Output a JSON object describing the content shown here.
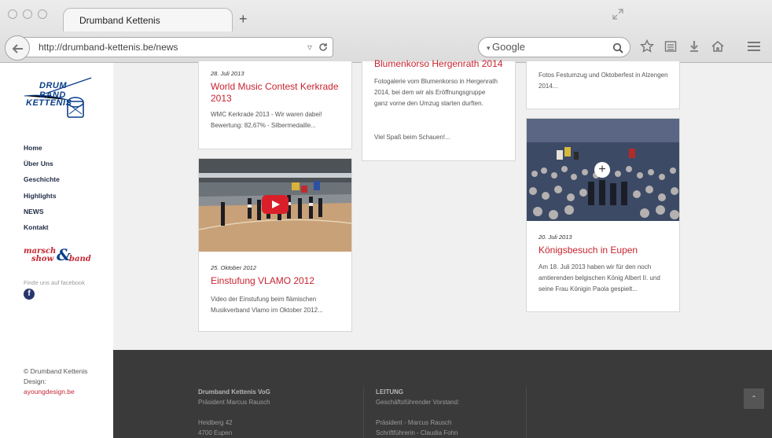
{
  "browser": {
    "tab_title": "Drumband Kettenis",
    "new_tab": "+",
    "url": "http://drumband-kettenis.be/news",
    "search_placeholder": "Google"
  },
  "sidebar": {
    "logo_line1": "DRUM BAND",
    "logo_line2": "KETTENIS",
    "nav": [
      "Home",
      "Über Uns",
      "Geschichte",
      "Highlights",
      "NEWS",
      "Kontakt"
    ],
    "marsch_logo_line1": "marsch",
    "marsch_logo_line2": "show",
    "marsch_logo_amp": "&",
    "marsch_logo_band": "band",
    "facebook_label": "Finde uns auf facebook",
    "facebook_letter": "f",
    "copyright": "© Drumband Kettenis",
    "design_label": "Design:",
    "design_link": "ayoungdesign.be"
  },
  "cards": [
    {
      "date": "28. Juli 2013",
      "title": "World Music Contest Kerkrade 2013",
      "excerpt": "WMC Kerkrade 2013 - Wir waren dabei! Bewertung: 82,67% - Silbermedaille..."
    },
    {
      "date": "25. Oktober 2012",
      "title": "Einstufung VLAMO 2012",
      "excerpt": "Video der Einstufung beim flämischen Musikverband Vlamo im Oktober 2012..."
    },
    {
      "title": "Blumenkorso Hergenrath 2014",
      "excerpt": "Fotogalerie vom Blumenkorso in Hergenrath 2014, bei dem wir als Eröffnungsgruppe ganz vorne den Umzug starten durften.",
      "excerpt2": "Viel Spaß beim Schauen!..."
    },
    {
      "excerpt": "Fotos Festumzug und Oktoberfest in Alzengen 2014..."
    },
    {
      "date": "20. Juli 2013",
      "title": "Königsbesuch in Eupen",
      "excerpt": "Am 18. Juli 2013 haben wir für den noch amtierenden belgischen König Albert II. und seine Frau Königin Paola gespielt..."
    }
  ],
  "footer": {
    "col1": {
      "heading": "Drumband Kettenis VoG",
      "line1": "Präsident Marcus Rausch",
      "line2": "Heidberg 42",
      "line3": "4700 Eupen"
    },
    "col2": {
      "heading": "LEITUNG",
      "line1": "Geschäftsführender Vorstand:",
      "line2": "Präsident - Marcus Rausch",
      "line3": "Schriftführerin - Claudia Fohn"
    },
    "to_top": "⌃"
  },
  "colors": {
    "accent_red": "#c7242f",
    "nav_dark": "#1f2a44",
    "logo_blue": "#0a3e8a",
    "footer_bg": "#3a3a3a",
    "main_bg": "#f0f0f0"
  }
}
